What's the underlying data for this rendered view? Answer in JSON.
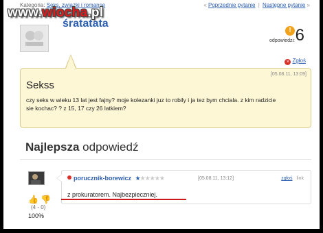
{
  "topbar": {
    "category_label": "Kategoria:",
    "category_link": "Seks, związki i romanse",
    "prev_link": "Poprzednie pytanie",
    "next_link": "Następne pytanie"
  },
  "watermark": {
    "part1": "www.",
    "part2": "wiocha",
    "part3": ".pl"
  },
  "asker": {
    "username": "śratatata"
  },
  "answers": {
    "label": "odpowiedzi:",
    "count": "6"
  },
  "report_label": "Zgłoś",
  "question": {
    "date": "[05.08.11, 13:09]",
    "title": "Sekss",
    "body": "czy seks w wieku 13 lat jest fajny? moje kolezanki juz to robily i ja tez bym chciala. z kim radzicie sie kochac? ? z 15, 17 czy 26 latkiem?"
  },
  "best_answer": {
    "heading_bold": "Najlepsza",
    "heading_rest": "odpowiedź"
  },
  "answer": {
    "author": "porucznik-borewicz",
    "rating": 1,
    "rating_max": 6,
    "date": "[05.08.11, 13:12]",
    "report": "zgłoś",
    "link": "link",
    "text": "z prokuratorem. Najbezpieczniej.",
    "votes": "(4 - 0)",
    "percent": "100%"
  },
  "colors": {
    "link": "#2a5db0",
    "question_bg": "#fdf7d6",
    "accent": "#cc1a1a"
  }
}
